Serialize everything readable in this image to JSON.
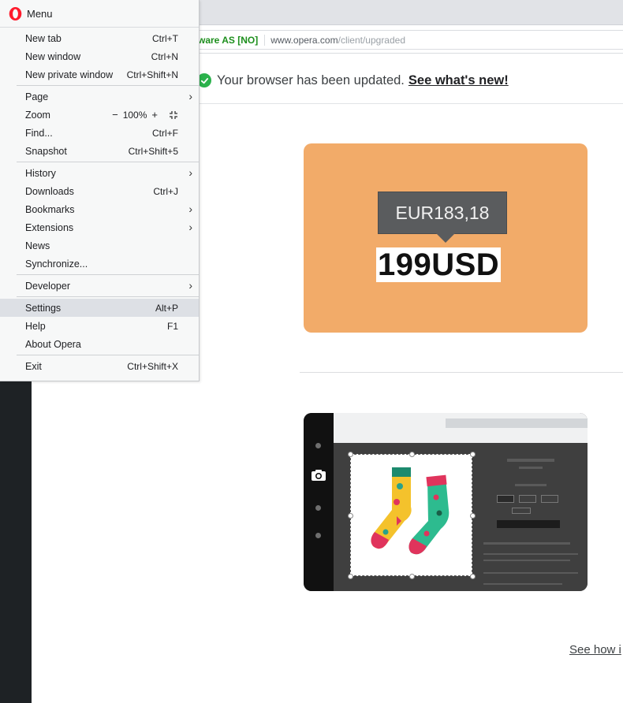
{
  "addressbar": {
    "secure_label": "ftware AS [NO]",
    "url_host": "www.opera.com",
    "url_path": "/client/upgraded"
  },
  "content": {
    "notice_text": "Your browser has been updated.",
    "notice_link": "See what's new!",
    "promo1_converted": "EUR183,18",
    "promo1_original": "199USD",
    "see_how_text": "See how i"
  },
  "menu": {
    "title": "Menu",
    "items": [
      {
        "label": "New tab",
        "shortcut": "Ctrl+T"
      },
      {
        "label": "New window",
        "shortcut": "Ctrl+N"
      },
      {
        "label": "New private window",
        "shortcut": "Ctrl+Shift+N"
      },
      {
        "label": "Page",
        "shortcut": ""
      },
      {
        "label": "Zoom",
        "shortcut": ""
      },
      {
        "label": "Find...",
        "shortcut": "Ctrl+F"
      },
      {
        "label": "Snapshot",
        "shortcut": "Ctrl+Shift+5"
      },
      {
        "label": "History",
        "shortcut": ""
      },
      {
        "label": "Downloads",
        "shortcut": "Ctrl+J"
      },
      {
        "label": "Bookmarks",
        "shortcut": ""
      },
      {
        "label": "Extensions",
        "shortcut": ""
      },
      {
        "label": "News",
        "shortcut": ""
      },
      {
        "label": "Synchronize...",
        "shortcut": ""
      },
      {
        "label": "Developer",
        "shortcut": ""
      },
      {
        "label": "Settings",
        "shortcut": "Alt+P"
      },
      {
        "label": "Help",
        "shortcut": "F1"
      },
      {
        "label": "About Opera",
        "shortcut": ""
      },
      {
        "label": "Exit",
        "shortcut": "Ctrl+Shift+X"
      }
    ],
    "zoom": {
      "minus": "−",
      "value": "100%",
      "plus": "+"
    },
    "highlighted": "Settings"
  },
  "colors": {
    "opera_red": "#ff1b2d",
    "check_green": "#2bb24c",
    "secure_green": "#1d8f1d",
    "promo_orange": "#f2ab69",
    "sidebar_dark": "#1e2225",
    "menu_highlight": "#dde0e5"
  }
}
